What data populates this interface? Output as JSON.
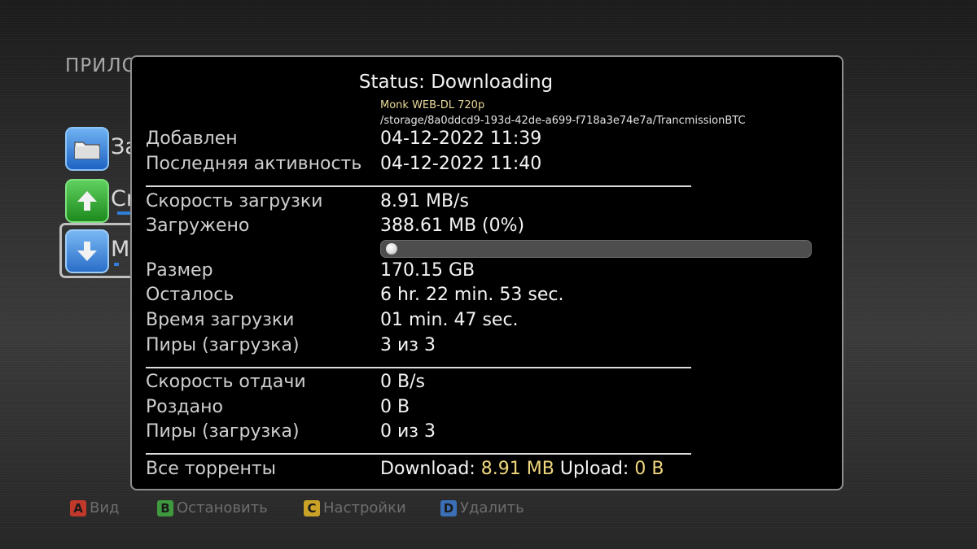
{
  "background_app": {
    "title": "ПРИЛО",
    "menu": [
      {
        "label": "За",
        "icon": "folder-icon",
        "color": "#2f7fd8"
      },
      {
        "label": "Cr",
        "icon": "up-arrow-icon",
        "color": "#2ea12e"
      },
      {
        "label": "M",
        "icon": "down-arrow-icon",
        "color": "#2f7fd8"
      }
    ]
  },
  "dialog": {
    "title": "Status: Downloading",
    "name": "Monk WEB-DL 720p",
    "path": "/storage/8a0ddcd9-193d-42de-a699-f718a3e74e7a/TrancmissionBTC",
    "added": {
      "label": "Добавлен",
      "value": "04-12-2022 11:39"
    },
    "last_activity": {
      "label": "Последняя активность",
      "value": "04-12-2022 11:40"
    },
    "download_speed": {
      "label": "Скорость загрузки",
      "value": "8.91 MB/s"
    },
    "downloaded": {
      "label": "Загружено",
      "value": "388.61 MB (0%)"
    },
    "progress_fraction": 0.0,
    "size": {
      "label": "Размер",
      "value": "170.15 GB"
    },
    "remaining": {
      "label": "Осталось",
      "value": "6 hr. 22 min. 53 sec."
    },
    "download_time": {
      "label": "Время загрузки",
      "value": "01 min. 47 sec."
    },
    "peers_download": {
      "label": "Пиры (загрузка)",
      "value": "3 из 3"
    },
    "upload_speed": {
      "label": "Скорость отдачи",
      "value": "0 B/s"
    },
    "seeded": {
      "label": "Роздано",
      "value": "0 B"
    },
    "peers_upload": {
      "label": "Пиры (загрузка)",
      "value": "0 из 3"
    },
    "all_torrents": {
      "label": "Все торренты",
      "download_label": "Download:",
      "download_value": "8.91 MB",
      "upload_label": "Upload:",
      "upload_value": "0 B"
    }
  },
  "hints": [
    {
      "key": "A",
      "label": "Вид",
      "color": "#c0392b"
    },
    {
      "key": "B",
      "label": "Остановить",
      "color": "#3f9a3f"
    },
    {
      "key": "C",
      "label": "Настройки",
      "color": "#c9a227"
    },
    {
      "key": "D",
      "label": "Удалить",
      "color": "#3b6fb5"
    }
  ],
  "colors": {
    "accent": "#f0d77e",
    "selection": "#2f7fd8"
  }
}
